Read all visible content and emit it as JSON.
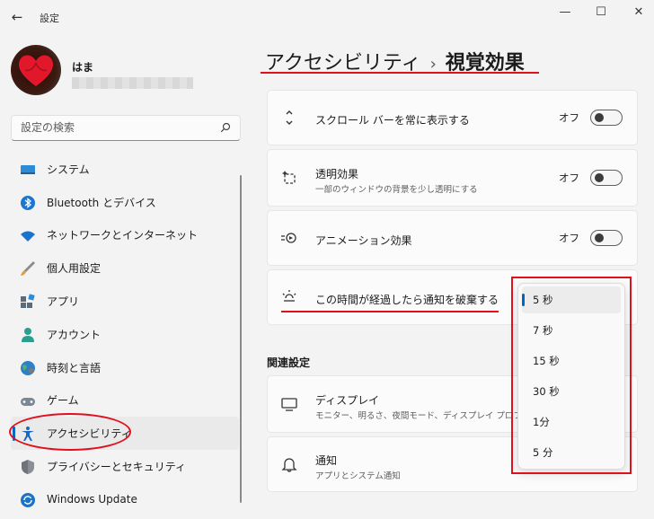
{
  "window": {
    "title": "設定",
    "back_glyph": "←",
    "minimize_glyph": "—",
    "maximize_glyph": "☐",
    "close_glyph": "✕"
  },
  "user": {
    "name": "はま"
  },
  "search": {
    "placeholder": "設定の検索"
  },
  "sidebar": {
    "items": [
      {
        "label": "システム",
        "icon": "system-icon"
      },
      {
        "label": "Bluetooth とデバイス",
        "icon": "bluetooth-icon"
      },
      {
        "label": "ネットワークとインターネット",
        "icon": "wifi-icon"
      },
      {
        "label": "個人用設定",
        "icon": "brush-icon"
      },
      {
        "label": "アプリ",
        "icon": "apps-icon"
      },
      {
        "label": "アカウント",
        "icon": "person-icon"
      },
      {
        "label": "時刻と言語",
        "icon": "globe-icon"
      },
      {
        "label": "ゲーム",
        "icon": "gamepad-icon"
      },
      {
        "label": "アクセシビリティ",
        "icon": "accessibility-icon",
        "selected": true
      },
      {
        "label": "プライバシーとセキュリティ",
        "icon": "shield-icon"
      },
      {
        "label": "Windows Update",
        "icon": "update-icon"
      }
    ]
  },
  "breadcrumb": {
    "parent": "アクセシビリティ",
    "separator": "›",
    "current": "視覚効果"
  },
  "settings": {
    "scrollbars": {
      "title": "スクロール バーを常に表示する",
      "state": "オフ"
    },
    "transparency": {
      "title": "透明効果",
      "subtitle": "一部のウィンドウの背景を少し透明にする",
      "state": "オフ"
    },
    "animation": {
      "title": "アニメーション効果",
      "state": "オフ"
    },
    "notification": {
      "title": "この時間が経過したら通知を破棄する"
    }
  },
  "related": {
    "heading": "関連設定",
    "display": {
      "title": "ディスプレイ",
      "subtitle": "モニター、明るさ、夜間モード、ディスプレイ プロファイル"
    },
    "notifications": {
      "title": "通知",
      "subtitle": "アプリとシステム通知"
    }
  },
  "dropdown": {
    "options": [
      "5 秒",
      "7 秒",
      "15 秒",
      "30 秒",
      "1分",
      "5 分"
    ],
    "selected": "5 秒"
  },
  "colors": {
    "accent": "#0067c0",
    "annotation": "#e0101e",
    "background": "#f3f3f3",
    "card": "#fbfbfb"
  }
}
